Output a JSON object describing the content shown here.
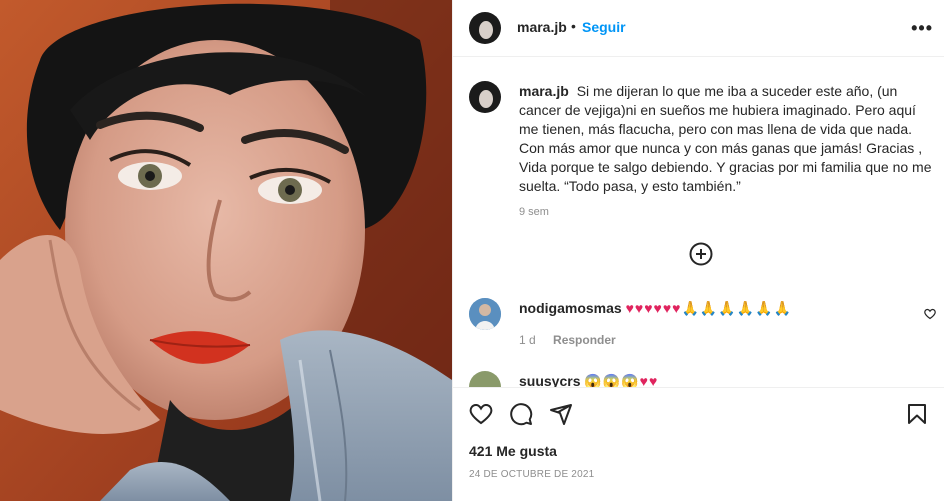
{
  "post": {
    "username": "mara.jb",
    "separator": "•",
    "follow_label": "Seguir",
    "more_label": "•••",
    "caption_text": "Si me dijeran lo que me iba a suceder este año, (un cancer de vejiga)ni en sueños me hubiera imaginado. Pero aquí me tienen, más flacucha, pero con mas llena de vida que nada. Con más amor que nunca y con más ganas que jamás! Gracias , Vida porque te salgo debiendo. Y gracias por mi familia que no me suelta. “Todo pasa, y esto también.”",
    "time_ago": "9 sem"
  },
  "comments": [
    {
      "username": "nodigamosmas",
      "emojis_hearts": "♥♥♥♥♥♥",
      "emojis_hands": "🙏🙏🙏🙏🙏🙏",
      "age": "1 d",
      "reply_label": "Responder"
    },
    {
      "username": "suusycrs",
      "emojis": "😱😱😱♥♥"
    }
  ],
  "footer": {
    "likes": "421 Me gusta",
    "date": "24 DE OCTUBRE DE 2021"
  },
  "icons": {
    "like": "heart-icon",
    "comment": "comment-icon",
    "share": "send-icon",
    "save": "bookmark-icon",
    "load_more": "plus-circle-icon"
  },
  "colors": {
    "accent": "#0095f6",
    "muted": "#8e8e8e",
    "heart": "#ed4956"
  }
}
